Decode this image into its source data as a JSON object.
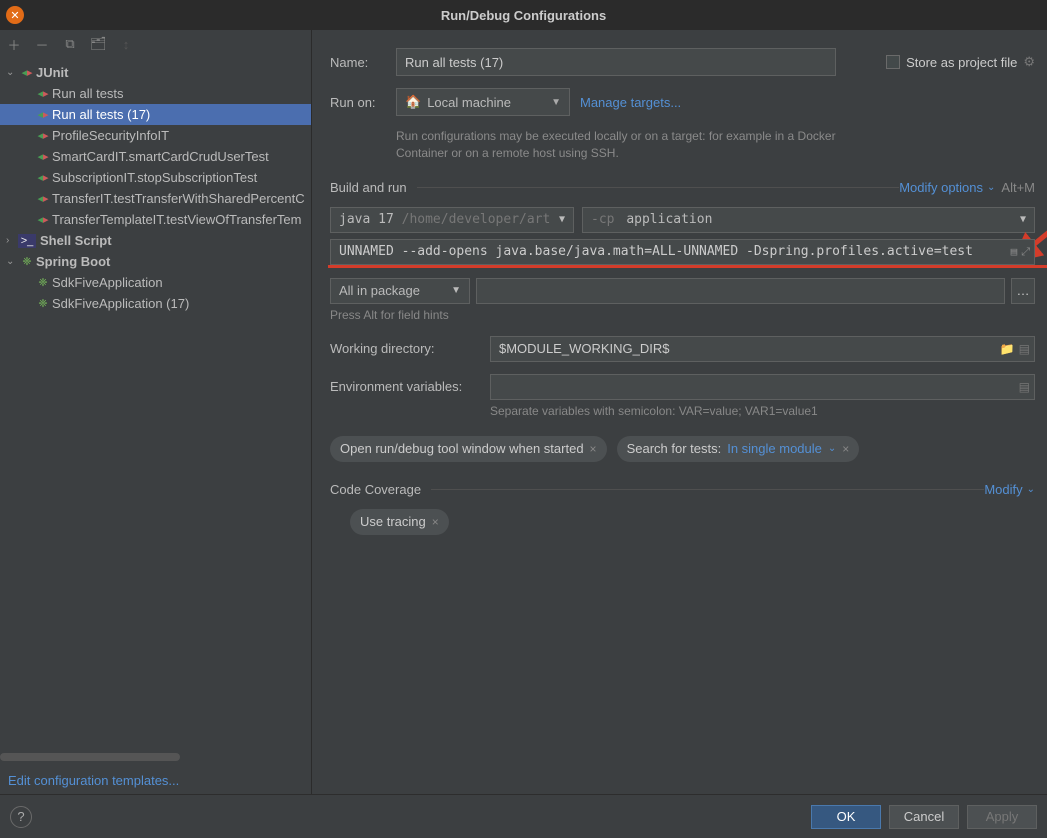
{
  "title": "Run/Debug Configurations",
  "tree": {
    "nodes": [
      {
        "kind": "group",
        "label": "JUnit",
        "expanded": true
      },
      {
        "kind": "junit",
        "label": "Run all tests"
      },
      {
        "kind": "junit",
        "label": "Run all tests (17)",
        "selected": true
      },
      {
        "kind": "junit",
        "label": "ProfileSecurityInfoIT"
      },
      {
        "kind": "junit",
        "label": "SmartCardIT.smartCardCrudUserTest"
      },
      {
        "kind": "junit",
        "label": "SubscriptionIT.stopSubscriptionTest"
      },
      {
        "kind": "junit",
        "label": "TransferIT.testTransferWithSharedPercentC"
      },
      {
        "kind": "junit",
        "label": "TransferTemplateIT.testViewOfTransferTem"
      },
      {
        "kind": "group",
        "label": "Shell Script",
        "expanded": false,
        "icon": "shell"
      },
      {
        "kind": "group",
        "label": "Spring Boot",
        "expanded": true,
        "icon": "spring"
      },
      {
        "kind": "spring",
        "label": "SdkFiveApplication"
      },
      {
        "kind": "spring",
        "label": "SdkFiveApplication (17)"
      }
    ]
  },
  "edit_templates": "Edit configuration templates...",
  "form": {
    "name_label": "Name:",
    "name_value": "Run all tests (17)",
    "store_label": "Store as project file",
    "runon_label": "Run on:",
    "runon_value": "Local machine",
    "manage_targets": "Manage targets...",
    "runon_hint": "Run configurations may be executed locally or on a target: for example in a Docker Container or on a remote host using SSH.",
    "build_title": "Build and run",
    "modify_options": "Modify options",
    "modify_shortcut": "Alt+M",
    "sdk_name": "java 17",
    "sdk_path": "/home/developer/art",
    "cp_flag": "-cp",
    "cp_value": "application",
    "vm_value": "UNNAMED --add-opens java.base/java.math=ALL-UNNAMED -Dspring.profiles.active=test",
    "scope_value": "All in package",
    "package_value": "",
    "field_hint": "Press Alt for field hints",
    "workdir_label": "Working directory:",
    "workdir_value": "$MODULE_WORKING_DIR$",
    "env_label": "Environment variables:",
    "env_value": "",
    "env_hint": "Separate variables with semicolon: VAR=value; VAR1=value1",
    "chip_open": "Open run/debug tool window when started",
    "chip_search_prefix": "Search for tests: ",
    "chip_search_value": "In single module",
    "coverage_title": "Code Coverage",
    "coverage_modify": "Modify",
    "chip_tracing": "Use tracing"
  },
  "footer": {
    "ok": "OK",
    "cancel": "Cancel",
    "apply": "Apply"
  }
}
